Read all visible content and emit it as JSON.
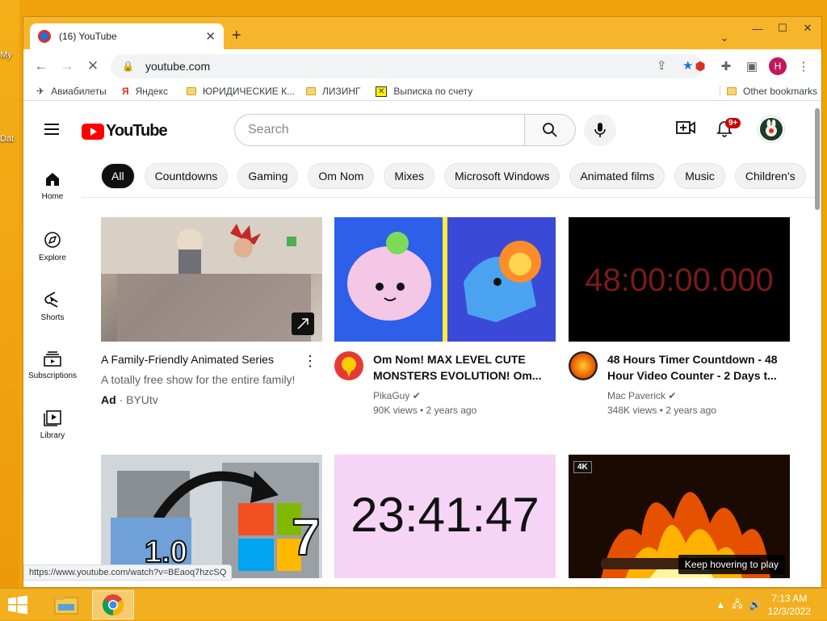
{
  "desktop": {
    "icon_labels": [
      "My",
      "Dat"
    ]
  },
  "browser": {
    "tab_title": "(16) YouTube",
    "address": "youtube.com",
    "profile_initial": "H",
    "bookmarks": [
      "Авиабилеты",
      "Яндекс",
      "ЮРИДИЧЕСКИЕ К...",
      "ЛИЗИНГ",
      "Выписка по счету"
    ],
    "other_bookmarks": "Other bookmarks",
    "status_url": "https://www.youtube.com/watch?v=BEaoq7hzcSQ"
  },
  "youtube": {
    "logo_text": "YouTube",
    "search_placeholder": "Search",
    "notification_badge": "9+",
    "nav": [
      {
        "label": "Home",
        "icon": "home-icon"
      },
      {
        "label": "Explore",
        "icon": "compass-icon"
      },
      {
        "label": "Shorts",
        "icon": "shorts-icon"
      },
      {
        "label": "Subscriptions",
        "icon": "subscriptions-icon"
      },
      {
        "label": "Library",
        "icon": "library-icon"
      }
    ],
    "chips": [
      "All",
      "Countdowns",
      "Gaming",
      "Om Nom",
      "Mixes",
      "Microsoft Windows",
      "Animated films",
      "Music",
      "Children's"
    ],
    "videos": [
      {
        "title": "A Family-Friendly Animated Series",
        "line2": "A totally free show for the entire family!",
        "ad_label": "Ad",
        "channel": "BYUtv"
      },
      {
        "title": "Om Nom! MAX LEVEL CUTE MONSTERS EVOLUTION! Om...",
        "channel": "PikaGuy",
        "stats": "90K views • 2 years ago"
      },
      {
        "title": "48 Hours Timer Countdown - 48 Hour Video Counter - 2 Days t...",
        "channel": "Mac Paverick",
        "stats": "348K views • 2 years ago",
        "thumb_text": "48:00:00.000"
      },
      {
        "thumb_text": "1.0"
      },
      {
        "thumb_text": "23:41:47"
      },
      {
        "badge": "4K",
        "tooltip": "Keep hovering to play"
      }
    ]
  },
  "taskbar": {
    "time": "7:13 AM",
    "date": "12/3/2022"
  }
}
